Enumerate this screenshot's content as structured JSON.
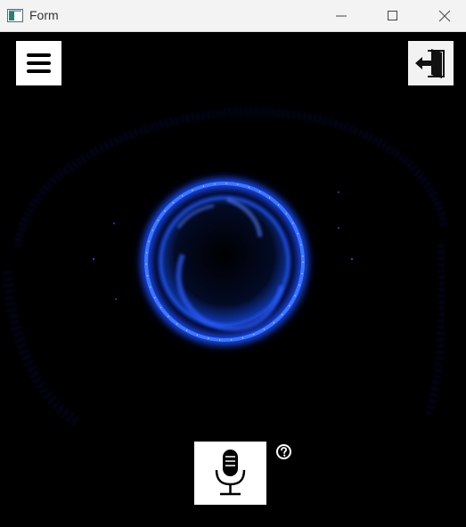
{
  "window": {
    "title": "Form",
    "controls": [
      "minimize",
      "maximize",
      "close"
    ]
  },
  "icons": {
    "menu": "hamburger-menu-icon",
    "exit": "exit-door-icon",
    "microphone": "microphone-icon",
    "help": "help-question-icon"
  },
  "colors": {
    "background": "#000000",
    "glow": "#2f6bff",
    "ring": "#1f5cff"
  }
}
